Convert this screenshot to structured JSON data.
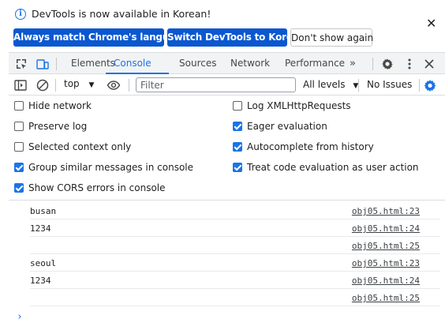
{
  "infobar": {
    "message": "DevTools is now available in Korean!",
    "buttons": {
      "match": "Always match Chrome's language",
      "switch": "Switch DevTools to Korean",
      "dismiss": "Don't show again"
    },
    "close_icon": "close-icon"
  },
  "tabs": [
    "Elements",
    "Console",
    "Sources",
    "Network",
    "Performance"
  ],
  "active_tab": "Console",
  "console_toolbar": {
    "context": "top",
    "filter_placeholder": "Filter",
    "levels": "All levels",
    "issues": "No Issues"
  },
  "settings": {
    "left": [
      {
        "label": "Hide network",
        "checked": false
      },
      {
        "label": "Preserve log",
        "checked": false
      },
      {
        "label": "Selected context only",
        "checked": false
      },
      {
        "label": "Group similar messages in console",
        "checked": true
      },
      {
        "label": "Show CORS errors in console",
        "checked": true
      }
    ],
    "right": [
      {
        "label": "Log XMLHttpRequests",
        "checked": false
      },
      {
        "label": "Eager evaluation",
        "checked": true
      },
      {
        "label": "Autocomplete from history",
        "checked": true
      },
      {
        "label": "Treat code evaluation as user action",
        "checked": true
      }
    ]
  },
  "messages": [
    {
      "text": "busan",
      "source": "obj05.html:23"
    },
    {
      "text": "1234",
      "source": "obj05.html:24"
    },
    {
      "text": "",
      "source": "obj05.html:25"
    },
    {
      "text": "seoul",
      "source": "obj05.html:23"
    },
    {
      "text": "1234",
      "source": "obj05.html:24"
    },
    {
      "text": "",
      "source": "obj05.html:25"
    }
  ],
  "prompt_symbol": "›",
  "colors": {
    "accent": "#1a73e8",
    "primary_button": "#0b57d0"
  }
}
